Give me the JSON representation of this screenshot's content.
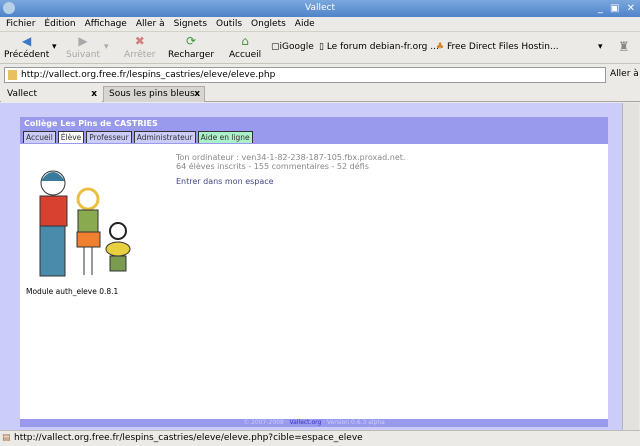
{
  "window": {
    "title": "Vallect"
  },
  "menu": [
    "Fichier",
    "Édition",
    "Affichage",
    "Aller à",
    "Signets",
    "Outils",
    "Onglets",
    "Aide"
  ],
  "toolbar": {
    "back": "Précédent",
    "forward": "Suivant",
    "stop": "Arrêter",
    "reload": "Recharger",
    "home": "Accueil"
  },
  "bookmarks": [
    "iGoogle",
    "Le forum debian-fr.org ...",
    "Free Direct Files Hostin..."
  ],
  "url": "http://vallect.org.free.fr/lespins_castries/eleve/eleve.php",
  "go_label": "Aller à",
  "tabs": [
    {
      "label": "Vallect",
      "close": "x"
    },
    {
      "label": "Sous les pins bleus",
      "close": "x"
    }
  ],
  "page": {
    "site_title": "Collège Les Pins de CASTRIES",
    "nav": [
      "Accueil",
      "Élève",
      "Professeur",
      "Administrateur",
      "Aide en ligne"
    ],
    "computer": "Ton ordinateur : ven34-1-82-238-187-105.fbx.proxad.net.",
    "stats": "64 élèves inscrits - 155 commentaires - 52 défis",
    "enter_link": "Entrer dans mon espace",
    "module": "Module auth_eleve 0.8.1",
    "footer": {
      "copyright": "© 2007-2008 ·",
      "site": "Vallect.org",
      "version": "· Version 0.6.3 alpha"
    }
  },
  "status": "http://vallect.org.free.fr/lespins_castries/eleve/eleve.php?cible=espace_eleve"
}
